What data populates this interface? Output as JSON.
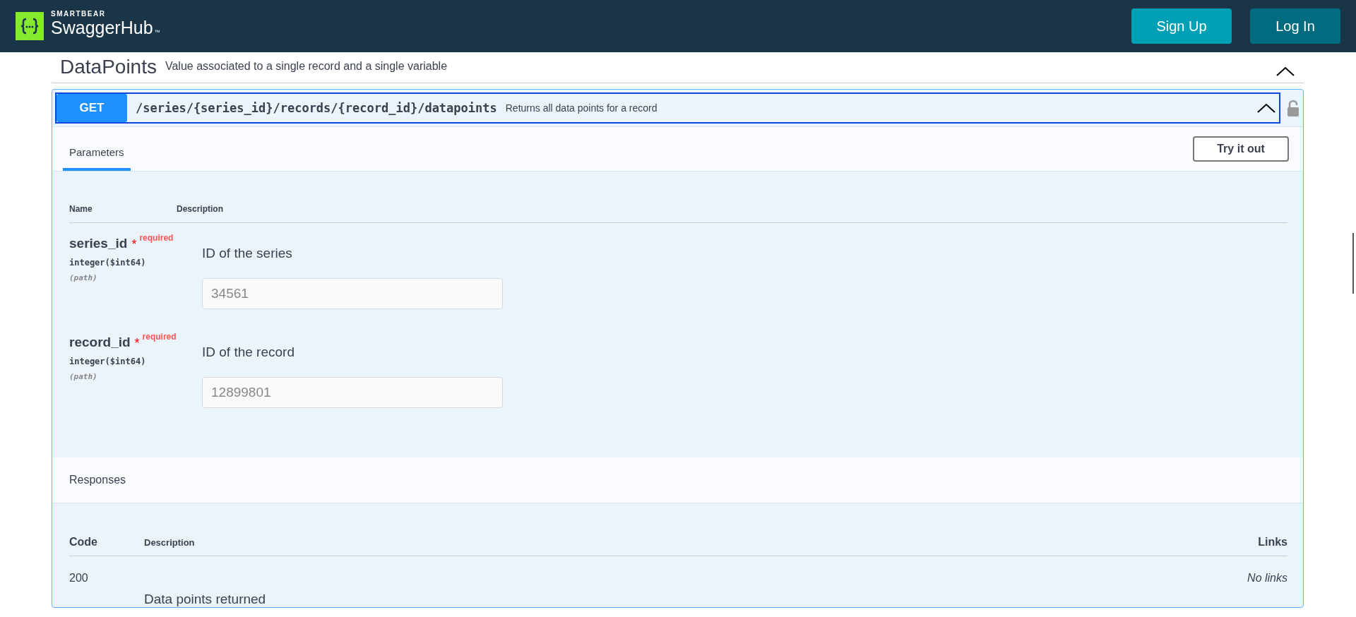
{
  "header": {
    "brand_top": "SMARTBEAR",
    "brand_name": "SwaggerHub",
    "trademark": "™",
    "buttons": [
      {
        "label": "Sign Up",
        "kind": "primary"
      },
      {
        "label": "Log In",
        "kind": "secondary"
      }
    ]
  },
  "section": {
    "title": "DataPoints",
    "description": "Value associated to a single record and a single variable",
    "expanded": true
  },
  "operation": {
    "method": "GET",
    "path": "/series/{series_id}/records/{record_id}/datapoints",
    "summary": "Returns all data points for a record",
    "expanded": true,
    "tabs": [
      {
        "label": "Parameters",
        "selected": true
      }
    ],
    "try_button": "Try it out",
    "param_columns": [
      "Name",
      "Description"
    ],
    "parameters": [
      {
        "name": "series_id",
        "required_mark": "*",
        "required": "required",
        "type": "integer",
        "format": "($int64)",
        "location": "(path)",
        "description": "ID of the series",
        "placeholder": "34561"
      },
      {
        "name": "record_id",
        "required_mark": "*",
        "required": "required",
        "type": "integer",
        "format": "($int64)",
        "location": "(path)",
        "description": "ID of the record",
        "placeholder": "12899801"
      }
    ],
    "responses_title": "Responses",
    "response_columns": [
      "Code",
      "Description",
      "Links"
    ],
    "responses": [
      {
        "code": "200",
        "description": "Data points returned",
        "links": "No links"
      }
    ]
  }
}
